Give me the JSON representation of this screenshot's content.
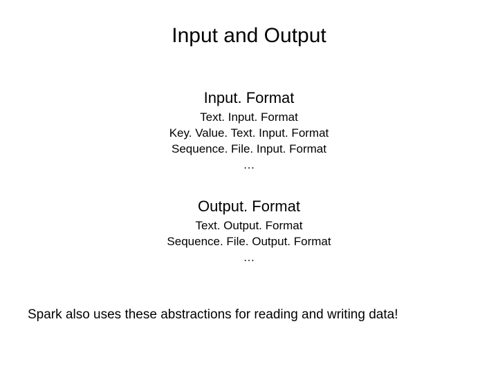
{
  "title": "Input and Output",
  "sections": [
    {
      "header": "Input. Format",
      "items": [
        "Text. Input. Format",
        "Key. Value. Text. Input. Format",
        "Sequence. File. Input. Format",
        "…"
      ]
    },
    {
      "header": "Output. Format",
      "items": [
        "Text. Output. Format",
        "Sequence. File. Output. Format",
        "…"
      ]
    }
  ],
  "footer": "Spark also uses these abstractions for reading and writing data!"
}
